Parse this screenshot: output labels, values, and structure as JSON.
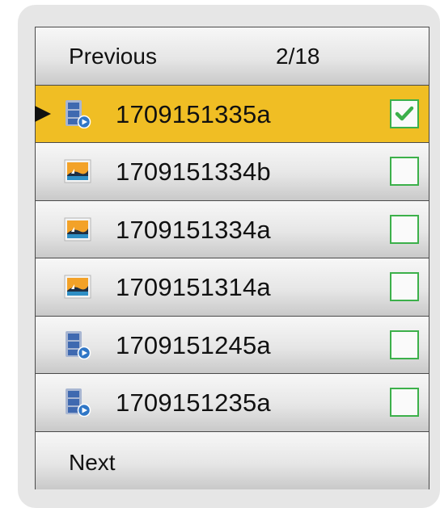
{
  "pager": {
    "previous_label": "Previous",
    "page_indicator": "2/18",
    "next_label": "Next"
  },
  "files": [
    {
      "name": "1709151335a",
      "type": "video",
      "checked": true,
      "selected": true
    },
    {
      "name": "1709151334b",
      "type": "image",
      "checked": false,
      "selected": false
    },
    {
      "name": "1709151334a",
      "type": "image",
      "checked": false,
      "selected": false
    },
    {
      "name": "1709151314a",
      "type": "image",
      "checked": false,
      "selected": false
    },
    {
      "name": "1709151245a",
      "type": "video",
      "checked": false,
      "selected": false
    },
    {
      "name": "1709151235a",
      "type": "video",
      "checked": false,
      "selected": false
    }
  ],
  "colors": {
    "selected_row": "#f0be24",
    "checkbox_border": "#3cb04a",
    "check_mark": "#3cb04a"
  },
  "icons": {
    "video": "video-file-icon",
    "image": "image-file-icon",
    "check": "check-icon",
    "pointer": "selection-pointer-icon"
  }
}
